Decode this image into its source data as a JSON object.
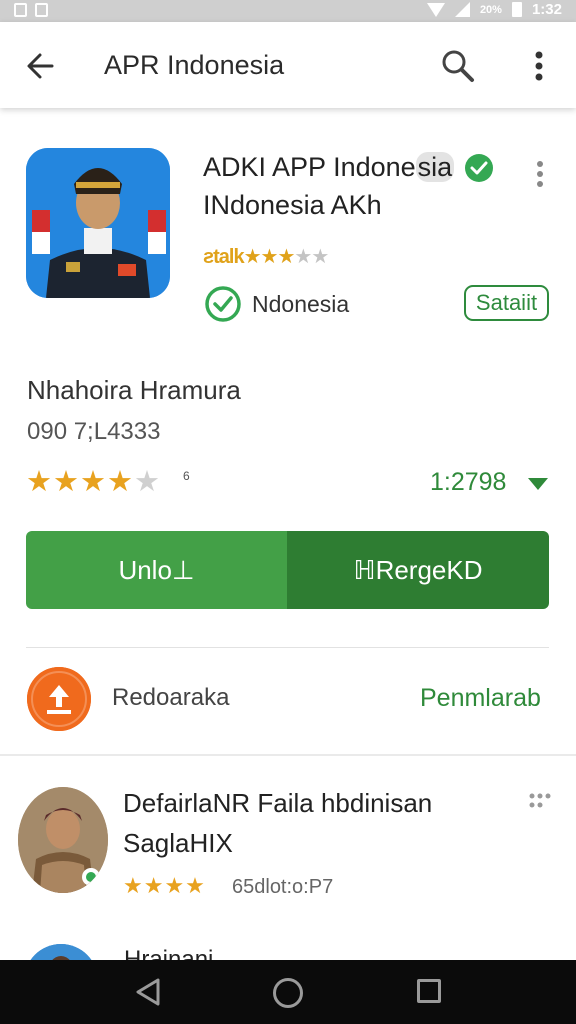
{
  "status_bar": {
    "battery_text": "20%",
    "time": "1:32"
  },
  "app_bar": {
    "title": "APR Indonesia"
  },
  "app_card": {
    "name_part1": "ADKI AP",
    "name_part2": "P Indone",
    "name_part3": "sia",
    "subtitle": "INdonesia AKh",
    "mini_rating_text": "ƨtalk",
    "mini_rating_gold": "★★★",
    "mini_rating_grey": "★★",
    "developer": "Ndonesia",
    "developer_badge": "Sataiit"
  },
  "review_summary": {
    "name": "Nhahoira Hramura",
    "phone": "090 7;L4333",
    "stars_gold": "★★★★",
    "stars_grey": "★",
    "rating_sup": "6",
    "count": "1:2798"
  },
  "buttons": {
    "left_label": "Unlo⊥",
    "right_label": "ℍRergeKD"
  },
  "update_row": {
    "label": "Redoaraka",
    "link": "Penmlarab"
  },
  "review_item": {
    "title": "DefairlaNR Faila hbdinisan",
    "subtitle": "SaglaHIX",
    "stars": "★★★★",
    "meta": "65dlot:o:P7"
  },
  "partial_item": {
    "text": "Hrainani"
  },
  "colors": {
    "accent_green": "#43a047",
    "dark_green": "#2e7d32",
    "star_gold": "#e8a21f",
    "update_orange": "#f06a1d"
  }
}
